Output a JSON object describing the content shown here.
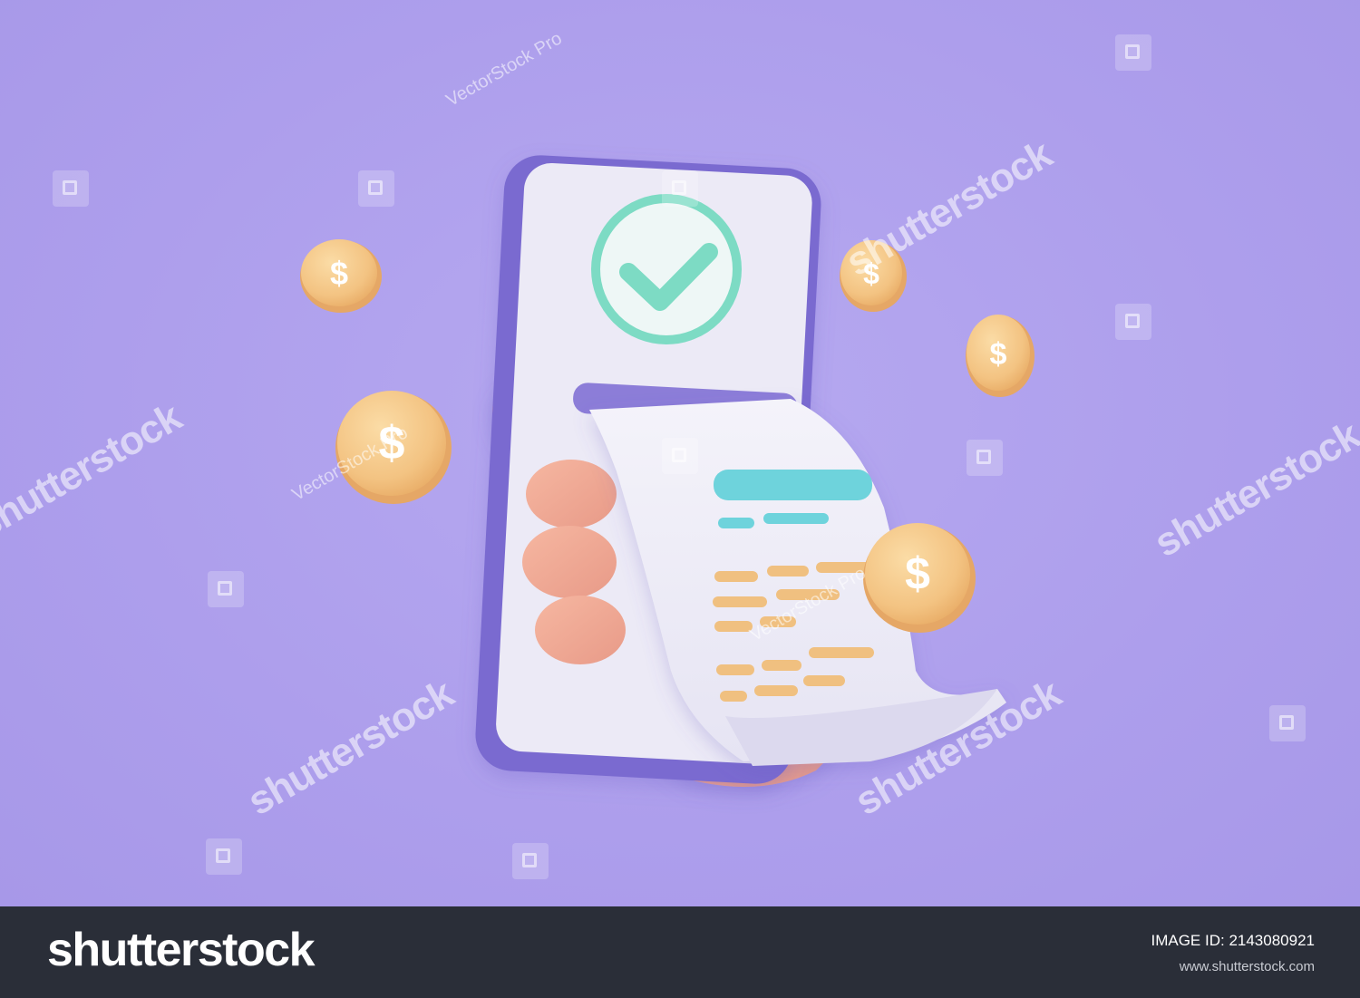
{
  "illustration": {
    "background_color": "#b2a4ec",
    "accent_check_color": "#7ddbc4",
    "coin_color": "#f5c98a",
    "receipt_header_color": "#6ed3dc",
    "receipt_line_color": "#f0c080",
    "phone_frame_color": "#7a6bd0",
    "coin_symbol": "$",
    "icons": [
      "check-icon",
      "dollar-coin-icon",
      "hand-icon",
      "smartphone-icon",
      "receipt-icon"
    ]
  },
  "watermarks": {
    "brand": "shutterstock",
    "vector_stock": "VectorStock Pro"
  },
  "footer": {
    "logo": "shutterstock",
    "image_id_label": "IMAGE ID: 2143080921",
    "url": "www.shutterstock.com"
  }
}
